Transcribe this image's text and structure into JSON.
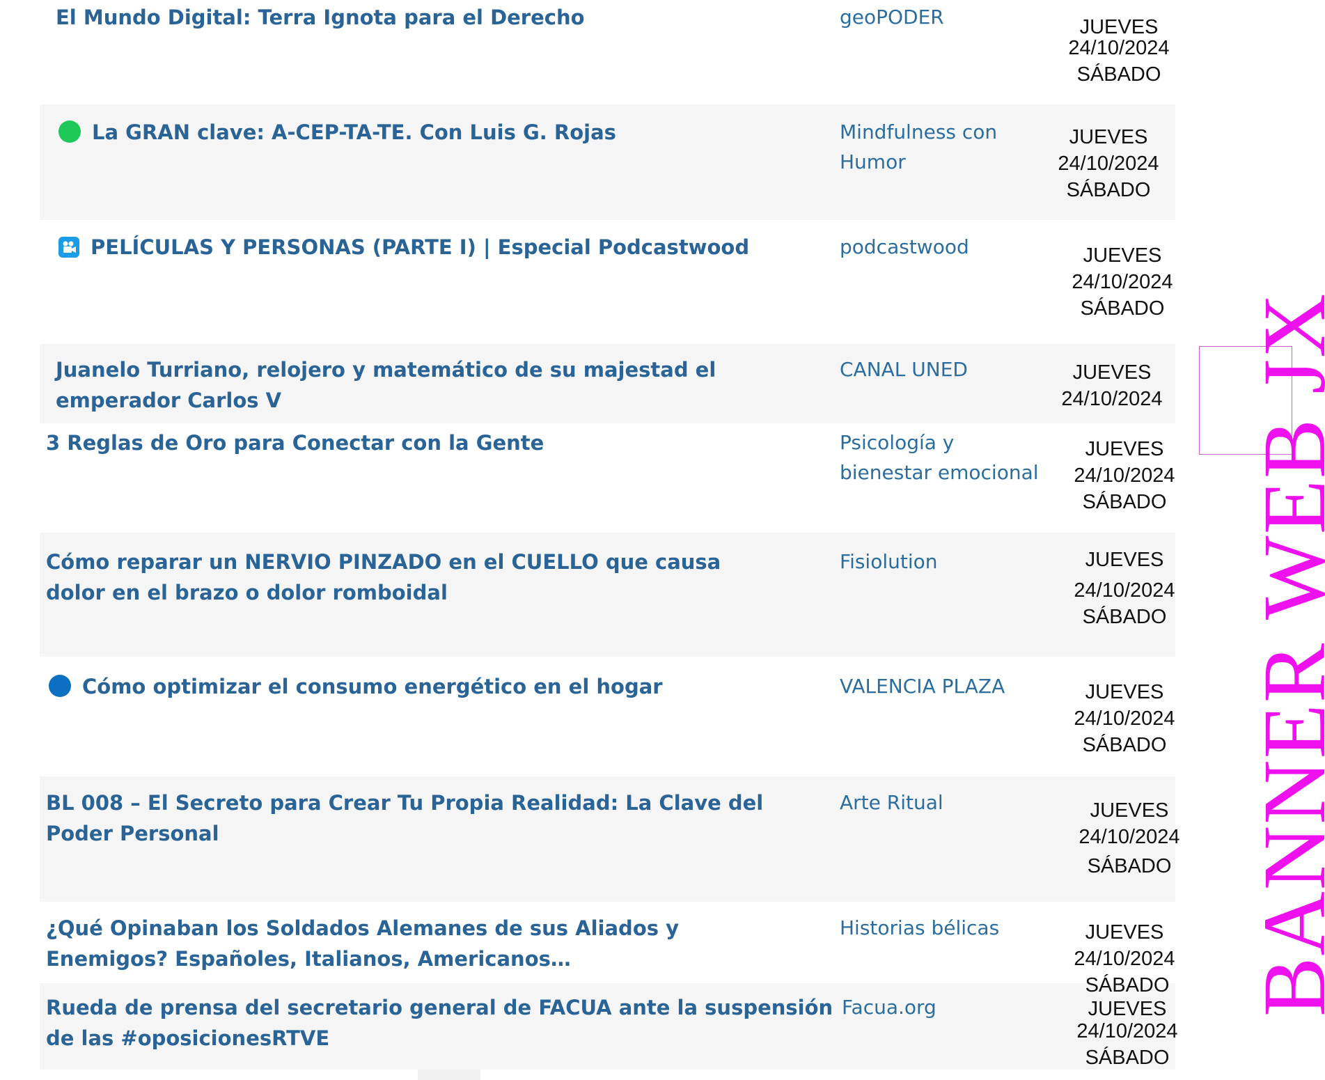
{
  "colors": {
    "title_link": "#2a6496",
    "channel_link": "#2a6d9e",
    "date_text": "#111111",
    "row_shade": "#f5f5f5",
    "banner": "#ee11ee",
    "green_dot": "#1ec95a",
    "blue_dot": "#0b6fc2",
    "camera_icon_bg": "#1c9be6"
  },
  "rows": [
    {
      "title": "El Mundo Digital: Terra Ignota para el Derecho",
      "icon": "",
      "channel": "geoPODER",
      "day1": "JUEVES",
      "date": "24/10/2024",
      "day2": "SÁBADO"
    },
    {
      "title": "La GRAN clave: A-CEP-TA-TE. Con Luis G. Rojas",
      "icon": "green-circle-icon",
      "channel": "Mindfulness con Humor",
      "day1": "JUEVES",
      "date": "24/10/2024",
      "day2": "SÁBADO"
    },
    {
      "title": "PELÍCULAS Y PERSONAS (PARTE I) | Especial Podcastwood",
      "icon": "movie-camera-icon",
      "channel": "podcastwood",
      "day1": "JUEVES",
      "date": "24/10/2024",
      "day2": "SÁBADO"
    },
    {
      "title": "Juanelo Turriano, relojero y matemático de su majestad el emperador Carlos V",
      "icon": "",
      "channel": "CANAL UNED",
      "day1": "JUEVES",
      "date": "24/10/2024",
      "day2": ""
    },
    {
      "title": "3 Reglas de Oro para Conectar con la Gente",
      "icon": "",
      "channel": "Psicología y bienestar emocional",
      "day1": "JUEVES",
      "date": "24/10/2024",
      "day2": "SÁBADO"
    },
    {
      "title": "Cómo reparar un NERVIO PINZADO en el CUELLO que causa dolor en el brazo o dolor romboidal",
      "icon": "",
      "channel": "Fisiolution",
      "day1": "JUEVES",
      "date": "24/10/2024",
      "day2": "SÁBADO"
    },
    {
      "title": "Cómo optimizar el consumo energético en el hogar",
      "icon": "blue-circle-icon",
      "channel": "VALENCIA PLAZA",
      "day1": "JUEVES",
      "date": "24/10/2024",
      "day2": "SÁBADO"
    },
    {
      "title": "BL 008 – El Secreto para Crear Tu Propia Realidad: La Clave del Poder Personal",
      "icon": "",
      "channel": "Arte Ritual",
      "day1": "JUEVES",
      "date": "24/10/2024",
      "day2": "SÁBADO"
    },
    {
      "title": "¿Qué Opinaban los Soldados Alemanes de sus Aliados y Enemigos? Españoles, Italianos, Americanos…",
      "icon": "",
      "channel": "Historias bélicas",
      "day1": "JUEVES",
      "date": "24/10/2024",
      "day2": "SÁBADO"
    },
    {
      "title": "Rueda de prensa del secretario general de FACUA ante la suspensión de las #oposicionesRTVE",
      "icon": "",
      "channel": "Facua.org",
      "day1": "JUEVES",
      "date": "24/10/2024",
      "day2": "SÁBADO"
    }
  ],
  "banner": {
    "text": "BANNER WEB JX"
  }
}
